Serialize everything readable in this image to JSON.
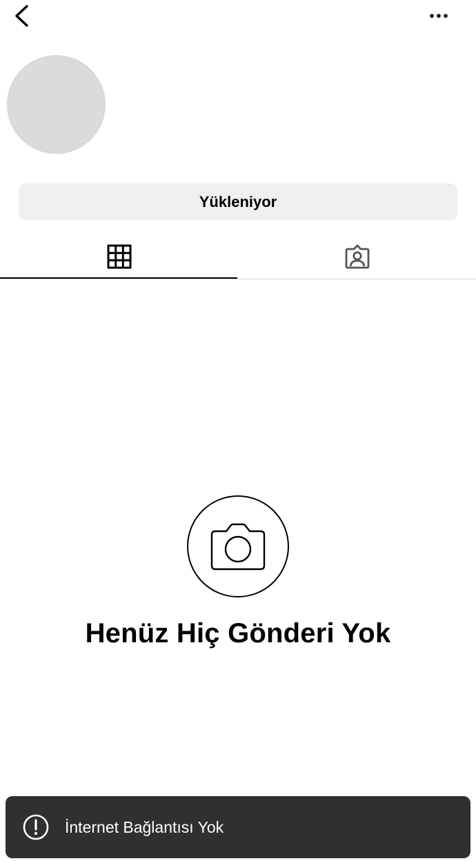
{
  "top_bar": {
    "back_icon": "chevron-left-icon",
    "more_icon": "more-horizontal-icon"
  },
  "profile": {
    "avatar_color": "#dbdbdb",
    "loading_button_label": "Yükleniyor"
  },
  "tabs": [
    {
      "name": "posts",
      "icon": "grid-icon",
      "active": true
    },
    {
      "name": "tagged",
      "icon": "tagged-user-icon",
      "active": false
    }
  ],
  "empty_state": {
    "icon": "camera-icon",
    "title": "Henüz Hiç Gönderi Yok"
  },
  "toast": {
    "icon": "exclamation-circle-icon",
    "message": "İnternet Bağlantısı Yok",
    "background": "#303030"
  }
}
